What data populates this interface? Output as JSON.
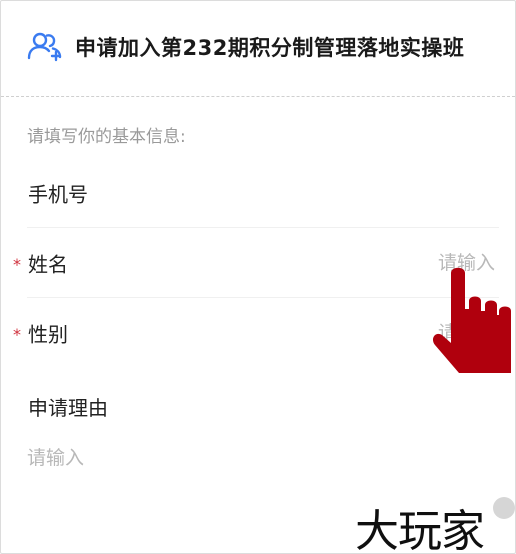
{
  "header": {
    "title": "申请加入第232期积分制管理落地实操班",
    "icon": "users-add-icon",
    "icon_color": "#3a7bf0"
  },
  "form": {
    "section_hint": "请填写你的基本信息:",
    "fields": [
      {
        "label": "手机号",
        "required": false,
        "value": ""
      },
      {
        "label": "姓名",
        "required": true,
        "placeholder": "请输入"
      },
      {
        "label": "性别",
        "required": true,
        "placeholder": "请输入"
      }
    ],
    "reason": {
      "label": "申请理由",
      "placeholder": "请输入"
    },
    "required_mark": "*",
    "required_color": "#d0303c"
  },
  "overlay": {
    "cursor_icon": "pointing-hand-icon",
    "cursor_color": "#b0000d"
  },
  "watermark": {
    "text": "大玩家"
  }
}
